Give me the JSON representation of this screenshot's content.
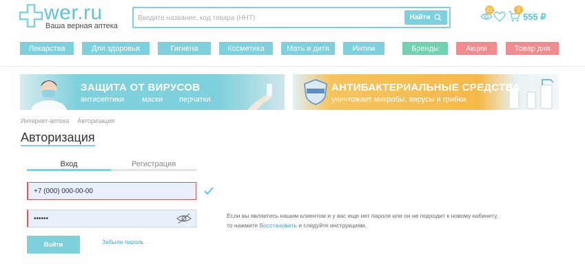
{
  "header": {
    "logo_text": "wer.ru",
    "logo_tagline": "Ваша верная аптека",
    "search_placeholder": "Введите название, код товара (ННТ)",
    "search_button": "Найти",
    "viewed_count": "21",
    "cart_count": "2",
    "cart_total": "555 ₽"
  },
  "nav": {
    "items": [
      "Лекарства",
      "Для здоровья",
      "Гигиена",
      "Косметика",
      "Мать и дитя",
      "Интим"
    ],
    "brands": "Бренды",
    "promo": "Акции",
    "deal": "Товар дня"
  },
  "banners": {
    "left": {
      "title": "ЗАЩИТА ОТ ВИРУСОВ",
      "items": [
        "антисептики",
        "маски",
        "перчатки"
      ]
    },
    "right": {
      "title": "АНТИБАКТЕРИАЛЬНЫЕ СРЕДСТВА",
      "subtitle": "уничтожает микробы, вирусы и грибки"
    }
  },
  "breadcrumb": [
    "Интернет-аптека",
    "Авторизация"
  ],
  "page_title": "Авторизация",
  "tabs": {
    "login": "Вход",
    "register": "Регистрация"
  },
  "form": {
    "phone_value": "+7 (000) 000-00-00",
    "password_value": "••••••",
    "submit": "Войти",
    "forgot": "Забыли пароль"
  },
  "info": {
    "line1": "Если вы являетесь нашим клиентом и у вас еще нет пароля или он не подходит к новому кабинету,",
    "line2_prefix": "то нажмите ",
    "line2_link": "Восстановить",
    "line2_suffix": " и следуйте инструкциям."
  },
  "colors": {
    "accent": "#7dd0dc",
    "brand_text": "#5bc6d8",
    "green": "#72d1b0",
    "pink": "#f08c8f",
    "badge": "#f5b94a",
    "error": "#e0565b"
  },
  "icons": [
    "plus-cross-logo-icon",
    "search-icon",
    "eye-icon",
    "heart-icon",
    "cart-icon",
    "check-icon",
    "eye-slash-icon"
  ]
}
